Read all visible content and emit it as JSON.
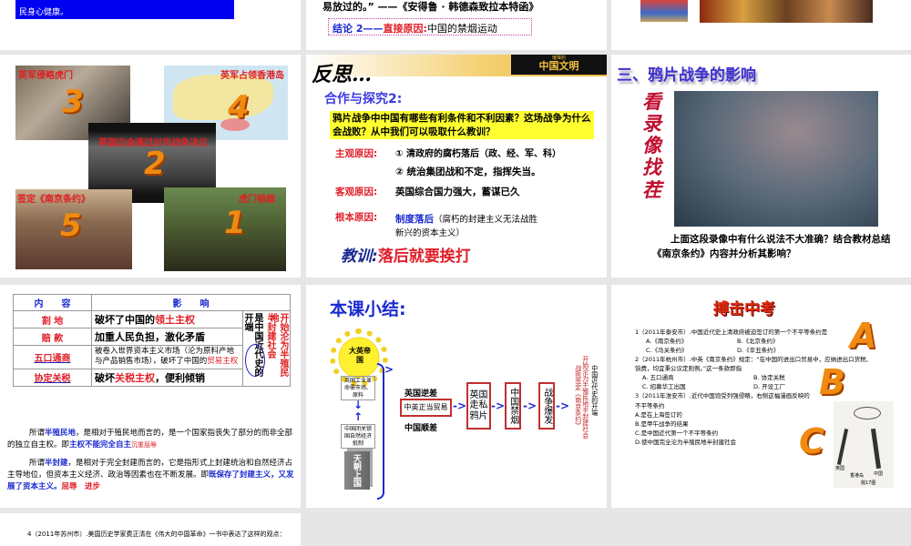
{
  "slides": [
    {
      "id": "prev-1",
      "lines": [
        "民身心健康。"
      ]
    },
    {
      "id": "prev-2",
      "quote": "易放过的。” ——《安得鲁 · 韩德森致拉本特函》",
      "conclusion_label": "结论 2——",
      "conclusion_key": "直接原因:",
      "conclusion_text": "中国的禁烟运动"
    },
    {
      "id": "prev-3"
    },
    {
      "id": "events",
      "captions": [
        "英军侵略虎门",
        "英军占领香港岛",
        "英国议会通过对华战争决议",
        "签定《南京条约》",
        "虎门销烟"
      ],
      "numbers": [
        "3",
        "4",
        "2",
        "5",
        "1"
      ]
    },
    {
      "id": "reflect",
      "title": "反思…",
      "banner": "中国文明",
      "banner_small": "璀璨的",
      "subtitle": "合作与探究2:",
      "question": "鸦片战争中中国有哪些有利条件和不利因素？这场战争为什么会战败？从中我们可以吸取什么教训？",
      "rows": [
        {
          "label": "主观原因:",
          "text": "① 清政府的腐朽落后（政、经、军、科）"
        },
        {
          "label": "",
          "text": "② 统治集团战和不定，指挥失当。"
        },
        {
          "label": "客观原因:",
          "text": "英国综合国力强大，蓄谋已久"
        },
        {
          "label": "根本原因:",
          "key": "制度落后",
          "text": "（腐朽的封建主义无法战胜新兴的资本主义）"
        }
      ],
      "lesson_label": "教训:",
      "lesson": "落后就要挨打"
    },
    {
      "id": "impact",
      "title": "三、鸦片战争的影响",
      "side": "看录像找茬",
      "question": "上面这段录像中有什么说法不大准确？结合教材总结《南京条约》内容并分析其影响？"
    },
    {
      "id": "table",
      "headers": [
        "内　　容",
        "影　　响"
      ],
      "rows": [
        {
          "c": "割 地",
          "pre": "破坏了中国的",
          "hl": "领土主权",
          "post": ""
        },
        {
          "c": "赔 款",
          "pre": "加重人民负担，激化矛盾",
          "hl": "",
          "post": ""
        },
        {
          "c": "五口通商",
          "pre": "被卷入世界资本主义市场（沦为原料产地与产品销售市场），破坏了中国的",
          "hl": "贸易主权",
          "post": ""
        },
        {
          "c": "协定关税",
          "pre": "破坏",
          "hl": "关税主权",
          "post": "，便利倾销"
        }
      ],
      "side_a": "开始沦为半殖民地",
      "side_b": "半封建社会",
      "side_c": "是中国近代史的开端",
      "p1_pre": "所谓",
      "p1_hl": "半殖民地",
      "p1_text": "，是相对于殖民地而言的，是一个国家指丧失了部分的而非全部的独立自主权。即",
      "p1_hl2": "主权不能完全自主",
      "p1_tag": "沉重屈辱",
      "p2_pre": "所谓",
      "p2_hl": "半封建",
      "p2_text": "，是相对于完全封建而言的，它是指形式上封建统治和自然经济占主导地位，但资本主义经济、政治等因素也在不断发展。即",
      "p2_hl2": "既保存了封建主义，又发展了资本主义。",
      "p2_tag": "屈辱　进步"
    },
    {
      "id": "summary",
      "title": "本课小结:",
      "sun": "大英帝国",
      "box_a": "英国工业革命需市场、原料",
      "box_b": "中国闭关锁国自然经济抵制",
      "pillar": "天朝上国",
      "top": "英国逆差",
      "trade": "中英正当贸易",
      "bottom": "中国顺差",
      "steps": [
        "英国走私鸦片",
        "中国禁烟",
        "战争爆发"
      ],
      "result_a": "战败签定《南京条约》",
      "result_b": "开始沦为半殖民地半封建社会",
      "result_c": "中国近代史的开端"
    },
    {
      "id": "exam",
      "title": "搏击中考",
      "q1": "1（2011年泰安市）.中国近代史上清政府被迫签订的第一个不平等条约是",
      "q1_opts": [
        "A.《南京条约》",
        "B.《北京条约》",
        "C.《马关条约》",
        "D.《辛丑条约》"
      ],
      "q2": "2（2011年杭州市）.中英《南京条约》规定：“在中国的进出口贸易中，应纳进出口货税、",
      "q2b": "饷费，均宜秉公议定则例。”这一条款即指",
      "q2_opts": [
        "A. 五口通商",
        "B. 协定关税",
        "C. 招募华工出国",
        "D. 开设工厂"
      ],
      "q3": "3（2011年淮安市）.近代中国饱受列强侵略，右侧这幅漫画反映的",
      "q3b": "不平等条约",
      "q3_opts": [
        "A.是在上海签订的",
        "B.是甲午战争的结果",
        "C.是中国近代第一个不平等条约",
        "D.使中国完全沦为半殖民地半封建社会"
      ],
      "letters": [
        "A",
        "B",
        "C"
      ],
      "cartoon_caption": "题17图",
      "cartoon_labels": [
        "英国",
        "香港岛",
        "中国"
      ]
    },
    {
      "id": "next",
      "q4": "4（2011年苏州市）.美国历史学家费正清在《伟大的中国革命》一书中表达了这样的观点："
    }
  ]
}
